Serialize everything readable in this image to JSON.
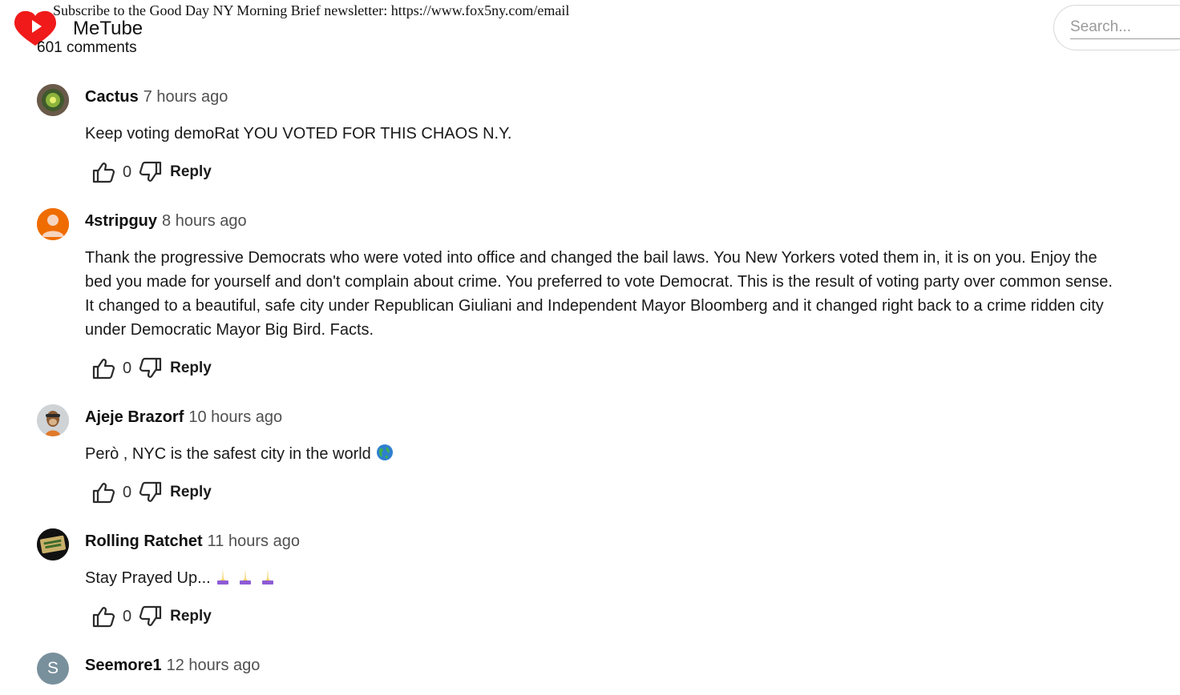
{
  "banner": {
    "text": "Subscribe to the Good Day NY Morning Brief newsletter: https://www.fox5ny.com/email"
  },
  "app": {
    "brand": "MeTube",
    "comments_count": "601 comments"
  },
  "search": {
    "placeholder": "Search..."
  },
  "colors": {
    "logo_red": "#f01a1a",
    "avatar_orange": "#ef6c00",
    "avatar_slate": "#78909c"
  },
  "comments": [
    {
      "author": "Cactus",
      "time": "7 hours ago",
      "text": "Keep voting demoRat YOU VOTED FOR THIS CHAOS N.Y.",
      "likes": "0",
      "reply_label": "Reply",
      "avatar_icon": "cactus-avatar-icon"
    },
    {
      "author": "4stripguy",
      "time": "8 hours ago",
      "text": "Thank the progressive Democrats who were voted into office and changed the bail laws. You New Yorkers voted them in, it is on you. Enjoy the bed you made for yourself and don't complain about crime. You preferred to vote Democrat. This is the result of voting party over common sense. It changed to a beautiful, safe city under Republican Giuliani and Independent Mayor Bloomberg and it changed right back to a crime ridden city under Democratic Mayor Big Bird. Facts.",
      "likes": "0",
      "reply_label": "Reply",
      "avatar_icon": "person-avatar-icon"
    },
    {
      "author": "Ajeje Brazorf",
      "time": "10 hours ago",
      "text": "Però , NYC is the safest city in the world",
      "likes": "0",
      "reply_label": "Reply",
      "avatar_icon": "ape-avatar-icon",
      "emoji_icons": [
        "globe-emoji-icon"
      ]
    },
    {
      "author": "Rolling Ratchet",
      "time": "11 hours ago",
      "text": "Stay Prayed Up...",
      "likes": "0",
      "reply_label": "Reply",
      "avatar_icon": "rolling-ratchet-avatar-icon",
      "emoji_icons": [
        "praying-hands-emoji-icon",
        "praying-hands-emoji-icon",
        "praying-hands-emoji-icon"
      ]
    },
    {
      "author": "Seemore1",
      "time": "12 hours ago",
      "avatar_letter": "S"
    }
  ]
}
